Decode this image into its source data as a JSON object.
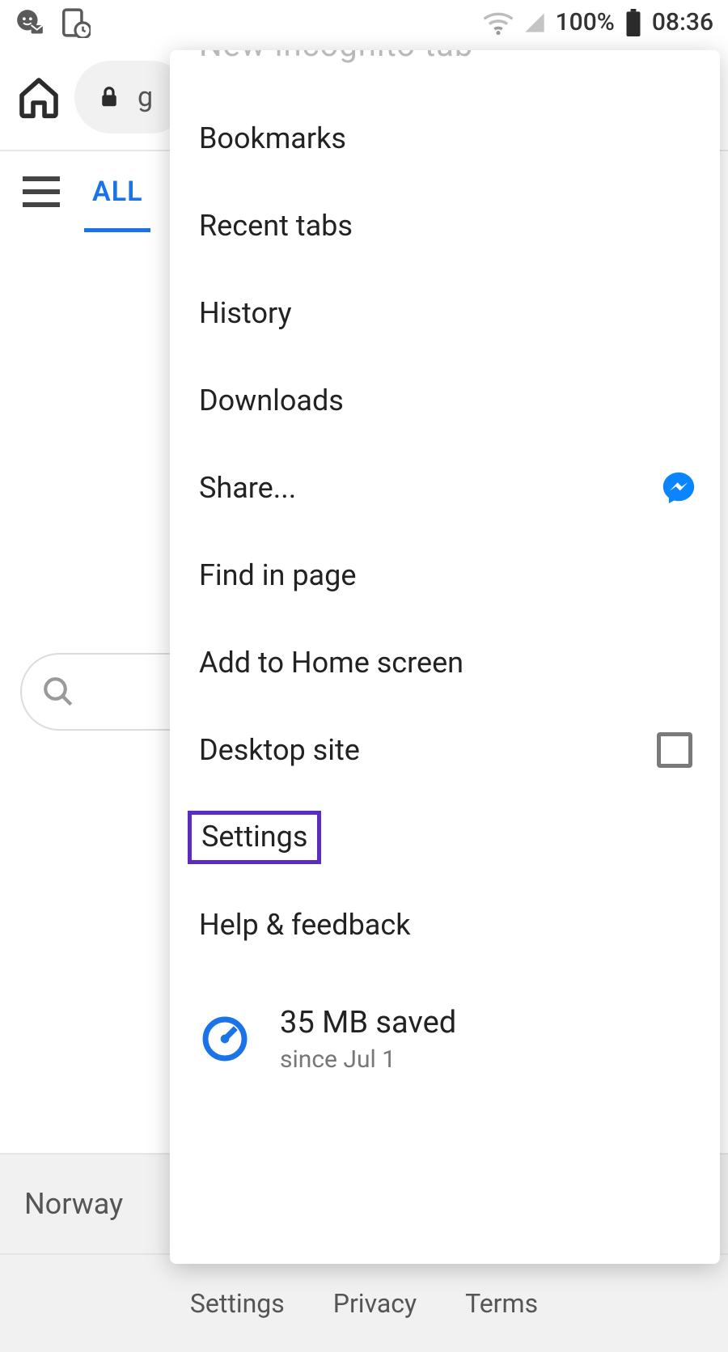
{
  "status": {
    "battery_percent": "100%",
    "clock": "08:36"
  },
  "browser": {
    "url_fragment": "g"
  },
  "page": {
    "tab_all": "ALL",
    "country": "Norway",
    "links": {
      "settings": "Settings",
      "privacy": "Privacy",
      "terms": "Terms"
    }
  },
  "menu": {
    "clipped_top": "New incognito tab",
    "bookmarks": "Bookmarks",
    "recent_tabs": "Recent tabs",
    "history": "History",
    "downloads": "Downloads",
    "share": "Share...",
    "find": "Find in page",
    "add_home": "Add to Home screen",
    "desktop": "Desktop site",
    "settings": "Settings",
    "help": "Help & feedback",
    "data_saved": {
      "line1": "35 MB saved",
      "line2": "since Jul 1"
    }
  }
}
